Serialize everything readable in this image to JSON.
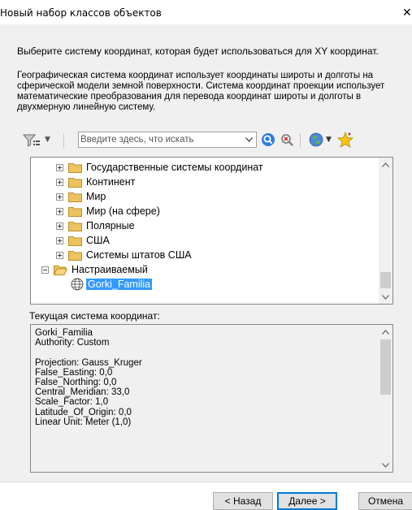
{
  "window": {
    "title": "Новый набор классов объектов",
    "close_glyph": "✕"
  },
  "instruction": "Выберите систему координат, которая будет использоваться для XY координат.",
  "description": "Географическая система координат использует координаты широты и долготы на сферической модели земной поверхности. Система координат проекции использует математические преобразования для перевода координат широты и долготы в двухмерную линейную систему.",
  "toolbar": {
    "search_placeholder": "Введите здесь, что искать",
    "icons": [
      "filter-icon",
      "search-icon",
      "clear-search-icon",
      "globe-icon",
      "new-star-icon"
    ]
  },
  "tree": {
    "items": [
      {
        "label": "Государственные системы координат",
        "state": "collapsed"
      },
      {
        "label": "Континент",
        "state": "collapsed"
      },
      {
        "label": "Мир",
        "state": "collapsed"
      },
      {
        "label": "Мир (на сфере)",
        "state": "collapsed"
      },
      {
        "label": "Полярные",
        "state": "collapsed"
      },
      {
        "label": "США",
        "state": "collapsed"
      },
      {
        "label": "Системы штатов США",
        "state": "collapsed"
      },
      {
        "label": "Настраиваемый",
        "state": "expanded"
      }
    ],
    "selected": {
      "label": "Gorki_Familia"
    }
  },
  "current": {
    "label": "Текущая система координат:",
    "details": "Gorki_Familia\nAuthority: Custom\n\nProjection: Gauss_Kruger\nFalse_Easting: 0,0\nFalse_Northing: 0,0\nCentral_Meridian: 33,0\nScale_Factor: 1,0\nLatitude_Of_Origin: 0,0\nLinear Unit: Meter (1,0)"
  },
  "buttons": {
    "back": "< Назад",
    "next": "Далее >",
    "cancel": "Отмена"
  },
  "colors": {
    "selection": "#3399ff",
    "folder": "#e8bf5a",
    "default_button_border": "#0078d7"
  }
}
